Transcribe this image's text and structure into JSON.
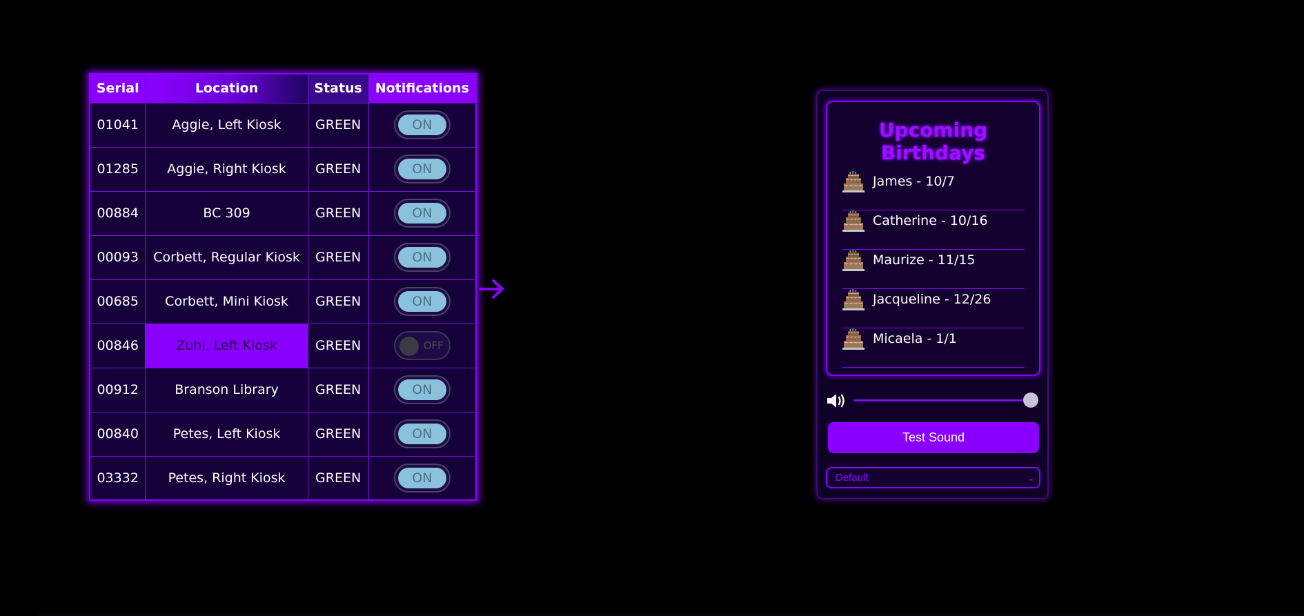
{
  "table": {
    "headers": {
      "serial": "Serial",
      "location": "Location",
      "status": "Status",
      "notifications": "Notifications"
    },
    "rows": [
      {
        "serial": "01041",
        "location": "Aggie, Left Kiosk",
        "status": "GREEN",
        "notify": "ON"
      },
      {
        "serial": "01285",
        "location": "Aggie, Right Kiosk",
        "status": "GREEN",
        "notify": "ON"
      },
      {
        "serial": "00884",
        "location": "BC 309",
        "status": "GREEN",
        "notify": "ON"
      },
      {
        "serial": "00093",
        "location": "Corbett, Regular Kiosk",
        "status": "GREEN",
        "notify": "ON"
      },
      {
        "serial": "00685",
        "location": "Corbett, Mini Kiosk",
        "status": "GREEN",
        "notify": "ON"
      },
      {
        "serial": "00846",
        "location": "Zuhl, Left Kiosk",
        "status": "GREEN",
        "notify": "OFF",
        "highlight": true
      },
      {
        "serial": "00912",
        "location": "Branson Library",
        "status": "GREEN",
        "notify": "ON"
      },
      {
        "serial": "00840",
        "location": "Petes, Left Kiosk",
        "status": "GREEN",
        "notify": "ON"
      },
      {
        "serial": "03332",
        "location": "Petes, Right Kiosk",
        "status": "GREEN",
        "notify": "ON"
      }
    ]
  },
  "birthdays": {
    "title": "Upcoming Birthdays",
    "items": [
      {
        "text": "James - 10/7",
        "icon": "cake-icon"
      },
      {
        "text": "Catherine - 10/16",
        "icon": "cake-icon"
      },
      {
        "text": "Maurize - 11/15",
        "icon": "cake-icon"
      },
      {
        "text": "Jacqueline - 12/26",
        "icon": "cake-icon"
      },
      {
        "text": "Micaela - 1/1",
        "icon": "cake-icon"
      }
    ]
  },
  "sound": {
    "volume": 1.0,
    "test_label": "Test Sound",
    "selected": "Default"
  },
  "colors": {
    "accent": "#8a00ff",
    "background": "#000000",
    "panel": "#14002e"
  }
}
